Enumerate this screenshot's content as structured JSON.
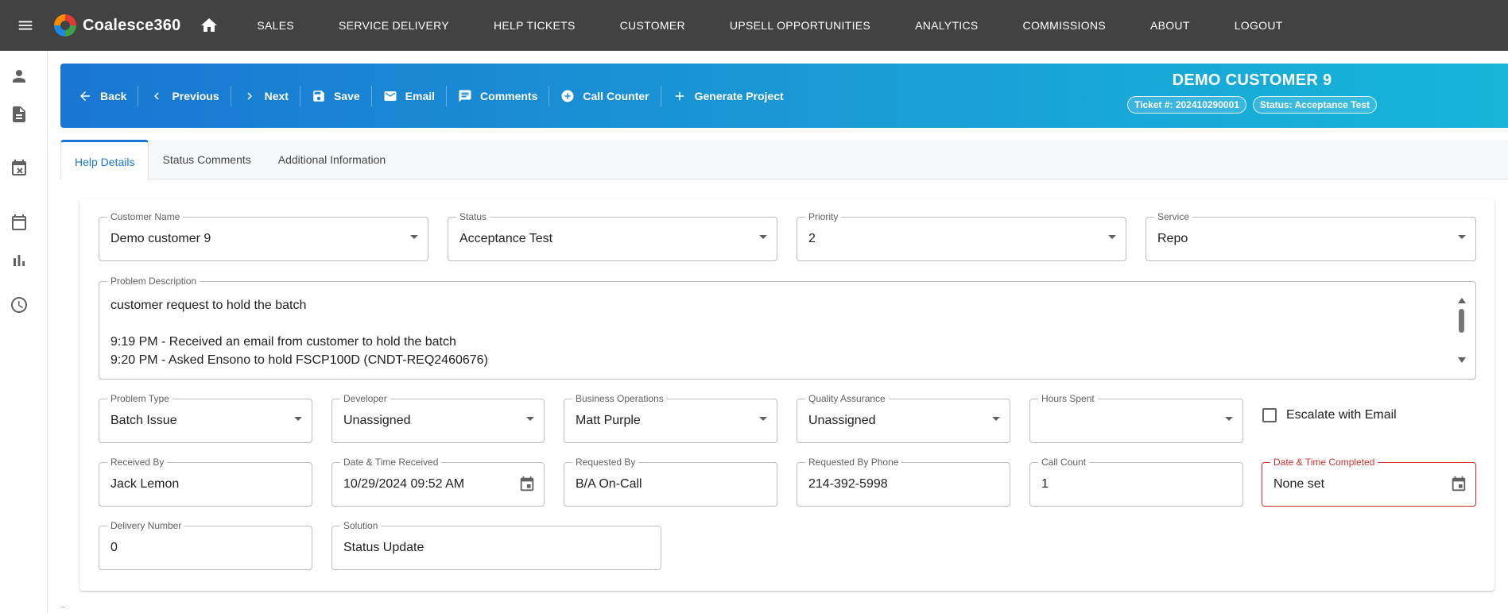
{
  "app": {
    "name": "Coalesce360",
    "nav": [
      "SALES",
      "SERVICE DELIVERY",
      "HELP TICKETS",
      "CUSTOMER",
      "UPSELL OPPORTUNITIES",
      "ANALYTICS",
      "COMMISSIONS",
      "ABOUT",
      "LOGOUT"
    ]
  },
  "sidebar": {
    "icons": [
      "person-icon",
      "document-icon",
      "calendar-x-icon",
      "calendar-icon",
      "bar-chart-icon",
      "clock-icon"
    ]
  },
  "toolbar": {
    "back": "Back",
    "previous": "Previous",
    "next": "Next",
    "save": "Save",
    "email": "Email",
    "comments": "Comments",
    "call_counter": "Call Counter",
    "generate_project": "Generate Project"
  },
  "header": {
    "customer_title": "DEMO CUSTOMER 9",
    "ticket_chip": "Ticket #: 202410290001",
    "status_chip": "Status: Acceptance Test"
  },
  "tabs": [
    "Help Details",
    "Status Comments",
    "Additional Information"
  ],
  "form": {
    "customer_name": {
      "label": "Customer Name",
      "value": "Demo customer 9"
    },
    "status": {
      "label": "Status",
      "value": "Acceptance Test"
    },
    "priority": {
      "label": "Priority",
      "value": "2"
    },
    "service": {
      "label": "Service",
      "value": "Repo"
    },
    "problem_description": {
      "label": "Problem Description",
      "lines": [
        "customer request to hold the batch",
        "",
        "9:19 PM - Received an email from customer to hold the batch",
        "9:20 PM - Asked Ensono to hold FSCP100D (CNDT-REQ2460676)"
      ]
    },
    "problem_type": {
      "label": "Problem Type",
      "value": "Batch Issue"
    },
    "developer": {
      "label": "Developer",
      "value": "Unassigned"
    },
    "business_operations": {
      "label": "Business Operations",
      "value": "Matt Purple"
    },
    "quality_assurance": {
      "label": "Quality Assurance",
      "value": "Unassigned"
    },
    "hours_spent": {
      "label": "Hours Spent",
      "value": ""
    },
    "escalate": {
      "label": "Escalate with Email",
      "checked": false
    },
    "received_by": {
      "label": "Received By",
      "value": "Jack Lemon"
    },
    "date_received": {
      "label": "Date & Time Received",
      "value": "10/29/2024 09:52 AM"
    },
    "requested_by": {
      "label": "Requested By",
      "value": "B/A On-Call"
    },
    "requested_by_phone": {
      "label": "Requested By Phone",
      "value": "214-392-5998"
    },
    "call_count": {
      "label": "Call Count",
      "value": "1"
    },
    "date_completed": {
      "label": "Date & Time Completed",
      "value": "None set"
    },
    "delivery_number": {
      "label": "Delivery Number",
      "value": "0"
    },
    "solution": {
      "label": "Solution",
      "value": "Status Update"
    }
  },
  "colors": {
    "topbar": "#424242",
    "accent": "#1976d2",
    "error": "#d32f2f"
  }
}
